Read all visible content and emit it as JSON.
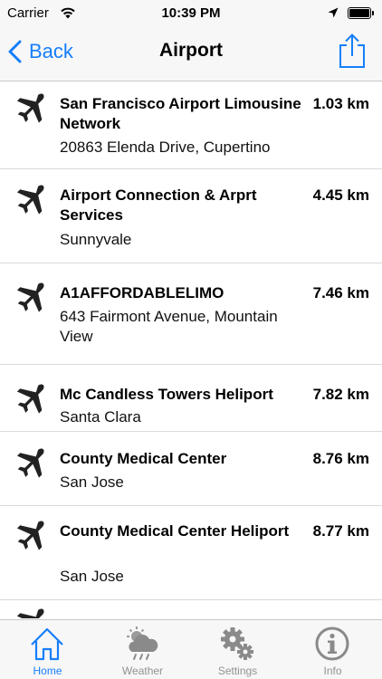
{
  "status_bar": {
    "carrier": "Carrier",
    "time": "10:39 PM"
  },
  "nav": {
    "back_label": "Back",
    "title": "Airport"
  },
  "places": [
    {
      "name": "San Francisco Airport Limousine Network",
      "distance": "1.03 km",
      "address": "20863 Elenda Drive, Cupertino"
    },
    {
      "name": "Airport Connection & Arprt Services",
      "distance": "4.45 km",
      "address": "Sunnyvale"
    },
    {
      "name": "A1AFFORDABLELIMO",
      "distance": "7.46 km",
      "address": "643 Fairmont Avenue, Mountain View"
    },
    {
      "name": "Mc Candless Towers Heliport",
      "distance": "7.82 km",
      "address": "Santa Clara"
    },
    {
      "name": "County Medical Center",
      "distance": "8.76 km",
      "address": "San Jose"
    },
    {
      "name": "County Medical Center Heliport",
      "distance": "8.77 km",
      "address": "San Jose"
    }
  ],
  "tabs": [
    {
      "label": "Home",
      "icon": "home-icon"
    },
    {
      "label": "Weather",
      "icon": "weather-icon"
    },
    {
      "label": "Settings",
      "icon": "settings-icon"
    },
    {
      "label": "Info",
      "icon": "info-icon"
    }
  ],
  "colors": {
    "accent": "#157efb",
    "inactive": "#929292",
    "bar_background": "#f7f7f7"
  }
}
